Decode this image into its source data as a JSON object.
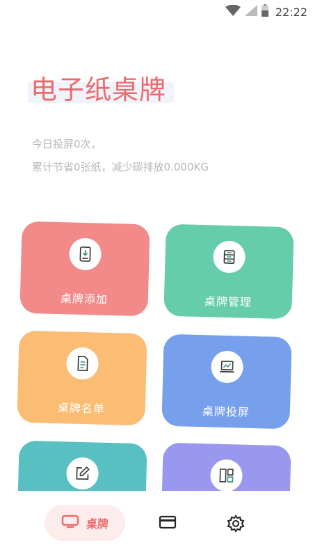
{
  "status_bar": {
    "time": "22:22",
    "icons": [
      "wifi-icon",
      "cell-signal-icon",
      "battery-icon"
    ]
  },
  "header": {
    "title": "电子纸桌牌",
    "stats_line1": "今日投屏0次，",
    "stats_line2": "累计节省0张纸，减少碳排放0.000KG"
  },
  "cards": [
    {
      "label": "桌牌添加",
      "icon": "tablet-download-icon",
      "color": "#f28a8a"
    },
    {
      "label": "桌牌管理",
      "icon": "server-icon",
      "color": "#65cda9"
    },
    {
      "label": "桌牌名单",
      "icon": "document-icon",
      "color": "#fbbd74"
    },
    {
      "label": "桌牌投屏",
      "icon": "laptop-chart-icon",
      "color": "#77a0ec"
    },
    {
      "label": "",
      "icon": "edit-icon",
      "color": "#58c0c2"
    },
    {
      "label": "",
      "icon": "layout-icon",
      "color": "#9a97f0"
    }
  ],
  "bottom_nav": {
    "tabs": [
      {
        "label": "桌牌",
        "icon": "monitor-icon",
        "active": true
      },
      {
        "label": "",
        "icon": "card-icon",
        "active": false
      },
      {
        "label": "",
        "icon": "gear-icon",
        "active": false
      }
    ]
  },
  "colors": {
    "accent": "#ec6a6d",
    "active_tab_bg": "#fdecec",
    "stat_text": "#b7b7b7"
  }
}
